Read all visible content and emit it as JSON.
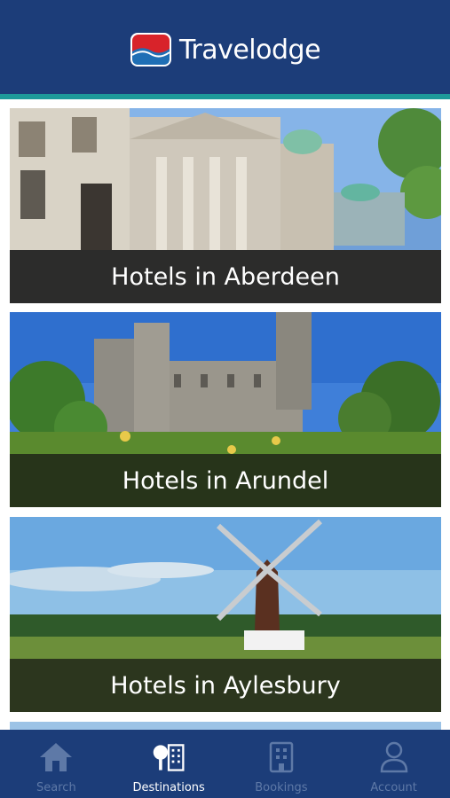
{
  "app": {
    "brand_name": "Travelodge"
  },
  "destinations": [
    {
      "label": "Hotels in Aberdeen"
    },
    {
      "label": "Hotels in Arundel"
    },
    {
      "label": "Hotels in Aylesbury"
    }
  ],
  "tabs": [
    {
      "label": "Search",
      "icon": "home-icon",
      "active": false
    },
    {
      "label": "Destinations",
      "icon": "destinations-icon",
      "active": true
    },
    {
      "label": "Bookings",
      "icon": "building-icon",
      "active": false
    },
    {
      "label": "Account",
      "icon": "person-icon",
      "active": false
    }
  ],
  "colors": {
    "header": "#1c3d79",
    "accent_strip": "#1d9a9a",
    "tab_inactive": "#5e79a7",
    "tab_active": "#ffffff"
  }
}
